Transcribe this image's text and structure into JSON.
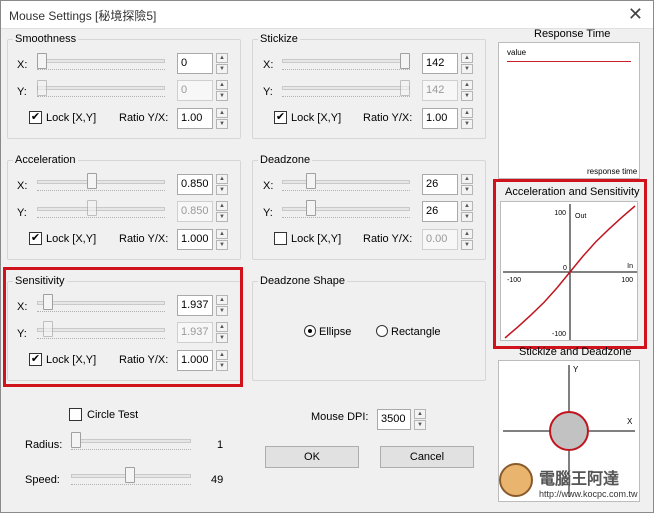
{
  "window": {
    "title": "Mouse Settings [秘境探險5]",
    "close_glyph": "✕"
  },
  "common": {
    "x": "X:",
    "y": "Y:",
    "lock": "Lock [X,Y]",
    "ratio": "Ratio Y/X:",
    "check": "✔",
    "up": "▲",
    "down": "▼"
  },
  "smoothness": {
    "title": "Smoothness",
    "x": "0",
    "y": "0",
    "ratio": "1.00",
    "x_level": 0.0,
    "y_level": 0.0,
    "locked": true
  },
  "stickize": {
    "title": "Stickize",
    "x": "142",
    "y": "142",
    "ratio": "1.00",
    "x_level": 1.0,
    "y_level": 1.0,
    "locked": true
  },
  "acceleration": {
    "title": "Acceleration",
    "x": "0.850",
    "y": "0.850",
    "ratio": "1.000",
    "x_level": 0.42,
    "y_level": 0.42,
    "locked": true
  },
  "deadzone": {
    "title": "Deadzone",
    "x": "26",
    "y": "26",
    "ratio": "0.00",
    "x_level": 0.2,
    "y_level": 0.2,
    "locked": false
  },
  "sensitivity": {
    "title": "Sensitivity",
    "x": "1.937",
    "y": "1.937",
    "ratio": "1.000",
    "x_level": 0.05,
    "y_level": 0.05,
    "locked": true
  },
  "deadzone_shape": {
    "title": "Deadzone Shape",
    "ellipse": "Ellipse",
    "rectangle": "Rectangle",
    "selected": "Ellipse"
  },
  "circle_test": {
    "label": "Circle Test",
    "checked": false
  },
  "radius": {
    "label": "Radius:",
    "value": "1",
    "level": 0.0
  },
  "speed": {
    "label": "Speed:",
    "value": "49",
    "level": 0.49
  },
  "mouse_dpi": {
    "label": "Mouse DPI:",
    "value": "3500"
  },
  "buttons": {
    "ok": "OK",
    "cancel": "Cancel"
  },
  "response_time": {
    "title": "Response Time",
    "value_label": "value",
    "xlabel": "response time"
  },
  "chart_data": {
    "type": "line",
    "title": "Acceleration and Sensitivity",
    "xlabel": "In",
    "ylabel": "Out",
    "xlim": [
      -100,
      100
    ],
    "ylim": [
      -100,
      100
    ],
    "x_ticks": [
      "-100",
      "0",
      "100"
    ],
    "y_ticks": [
      "100",
      "-100"
    ],
    "series": [
      {
        "x": [
          -100,
          -80,
          -60,
          -40,
          -20,
          0,
          20,
          40,
          60,
          80,
          100
        ],
        "values": [
          -100,
          -83,
          -65,
          -46,
          -24,
          0,
          24,
          46,
          65,
          83,
          100
        ]
      }
    ]
  },
  "stickize_deadzone": {
    "title": "Stickize and Deadzone",
    "y_label": "Y",
    "x_label": "X"
  },
  "watermark": {
    "site": "電腦王阿達",
    "url": "http://www.kocpc.com.tw"
  },
  "colors": {
    "highlight": "#d0121d",
    "curve": "#c0151f",
    "line": "#c81f2a"
  }
}
